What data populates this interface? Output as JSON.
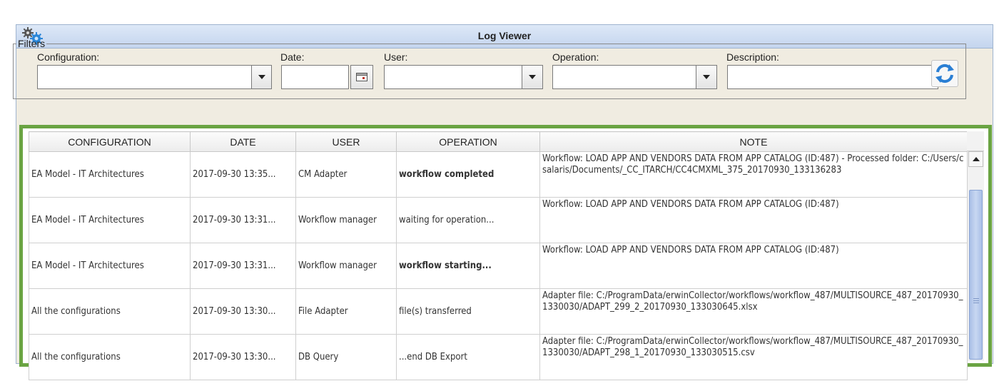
{
  "window": {
    "title": "Log Viewer",
    "icon": "gear-icon"
  },
  "filters": {
    "legend": "Filters",
    "configuration_label": "Configuration:",
    "configuration_value": "",
    "date_label": "Date:",
    "date_value": "",
    "user_label": "User:",
    "user_value": "",
    "operation_label": "Operation:",
    "operation_value": "",
    "description_label": "Description:",
    "description_value": "",
    "refresh_icon": "refresh-icon"
  },
  "table": {
    "columns": [
      "CONFIGURATION",
      "DATE",
      "USER",
      "OPERATION",
      "NOTE"
    ],
    "rows": [
      {
        "configuration": "EA Model - IT Architectures",
        "date": "2017-09-30 13:35...",
        "user": "CM Adapter",
        "operation": "workflow completed",
        "note": "Workflow: LOAD APP AND VENDORS DATA FROM APP CATALOG (ID:487) - Processed folder: C:/Users/csalaris/Documents/_CC_ITARCH/CC4CMXML_375_20170930_133136283"
      },
      {
        "configuration": "EA Model - IT Architectures",
        "date": "2017-09-30 13:31...",
        "user": "Workflow manager",
        "operation": "waiting for operation...",
        "note": "Workflow: LOAD APP AND VENDORS DATA FROM APP CATALOG (ID:487)"
      },
      {
        "configuration": "EA Model - IT Architectures",
        "date": "2017-09-30 13:31...",
        "user": "Workflow manager",
        "operation": "workflow starting...",
        "note": "Workflow: LOAD APP AND VENDORS DATA FROM APP CATALOG (ID:487)"
      },
      {
        "configuration": "All the configurations",
        "date": "2017-09-30 13:30...",
        "user": "File Adapter",
        "operation": "file(s) transferred",
        "note": "Adapter file: C:/ProgramData/erwinCollector/workflows/workflow_487/MULTISOURCE_487_20170930_1330030/ADAPT_299_2_20170930_133030645.xlsx"
      },
      {
        "configuration": "All the configurations",
        "date": "2017-09-30 13:30...",
        "user": "DB Query",
        "operation": "...end DB Export",
        "note": "Adapter file: C:/ProgramData/erwinCollector/workflows/workflow_487/MULTISOURCE_487_20170930_1330030/ADAPT_298_1_20170930_133030515.csv"
      }
    ]
  },
  "colors": {
    "highlight_frame": "#6aa442",
    "completed_text": "#1fa54a",
    "titlebar": "#c4d5ee"
  }
}
